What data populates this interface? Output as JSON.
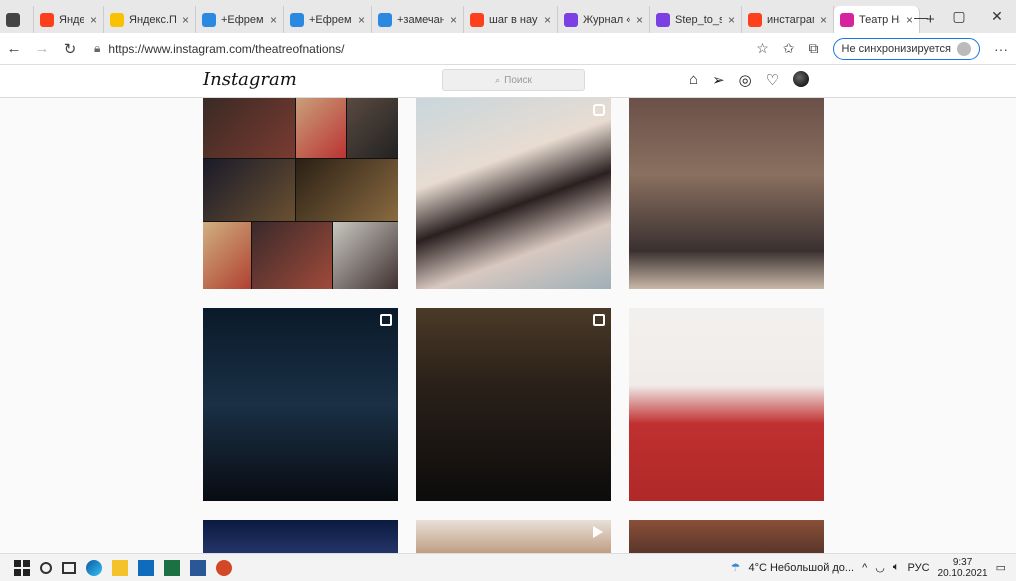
{
  "tabs": [
    {
      "label": "",
      "icon": "window-icon",
      "color": "#444444"
    },
    {
      "label": "Яндекс",
      "icon": "yandex-icon",
      "color": "#fc3f1d"
    },
    {
      "label": "Яндекс.По",
      "icon": "yandex-mail-icon",
      "color": "#f8c200"
    },
    {
      "label": "+Ефремов",
      "icon": "doc-icon",
      "color": "#2b8ae0"
    },
    {
      "label": "+Ефремов",
      "icon": "doc-icon",
      "color": "#2b8ae0"
    },
    {
      "label": "+замечани",
      "icon": "doc-icon",
      "color": "#2b8ae0"
    },
    {
      "label": "шаг в наук",
      "icon": "yandex-icon",
      "color": "#fc3f1d"
    },
    {
      "label": "Журнал «Ш",
      "icon": "journal-icon",
      "color": "#7b3fe4"
    },
    {
      "label": "Step_to_sci",
      "icon": "journal-icon",
      "color": "#7b3fe4"
    },
    {
      "label": "инстаграм",
      "icon": "yandex-icon",
      "color": "#fc3f1d"
    },
    {
      "label": "Театр Наци",
      "icon": "instagram-icon",
      "color": "#d6249f"
    }
  ],
  "new_tab": "+",
  "window": {
    "minimize": "—",
    "restore": "▢",
    "close": "✕"
  },
  "address": {
    "url": "https://www.instagram.com/theatreofnations/",
    "sync_label": "Не синхронизируется",
    "more": "···"
  },
  "instagram": {
    "logo": "Instagram",
    "search_placeholder": "Поиск"
  },
  "taskbar": {
    "weather": "4°C Небольшой до...",
    "lang": "РУС",
    "time": "9:37",
    "date": "20.10.2021"
  }
}
